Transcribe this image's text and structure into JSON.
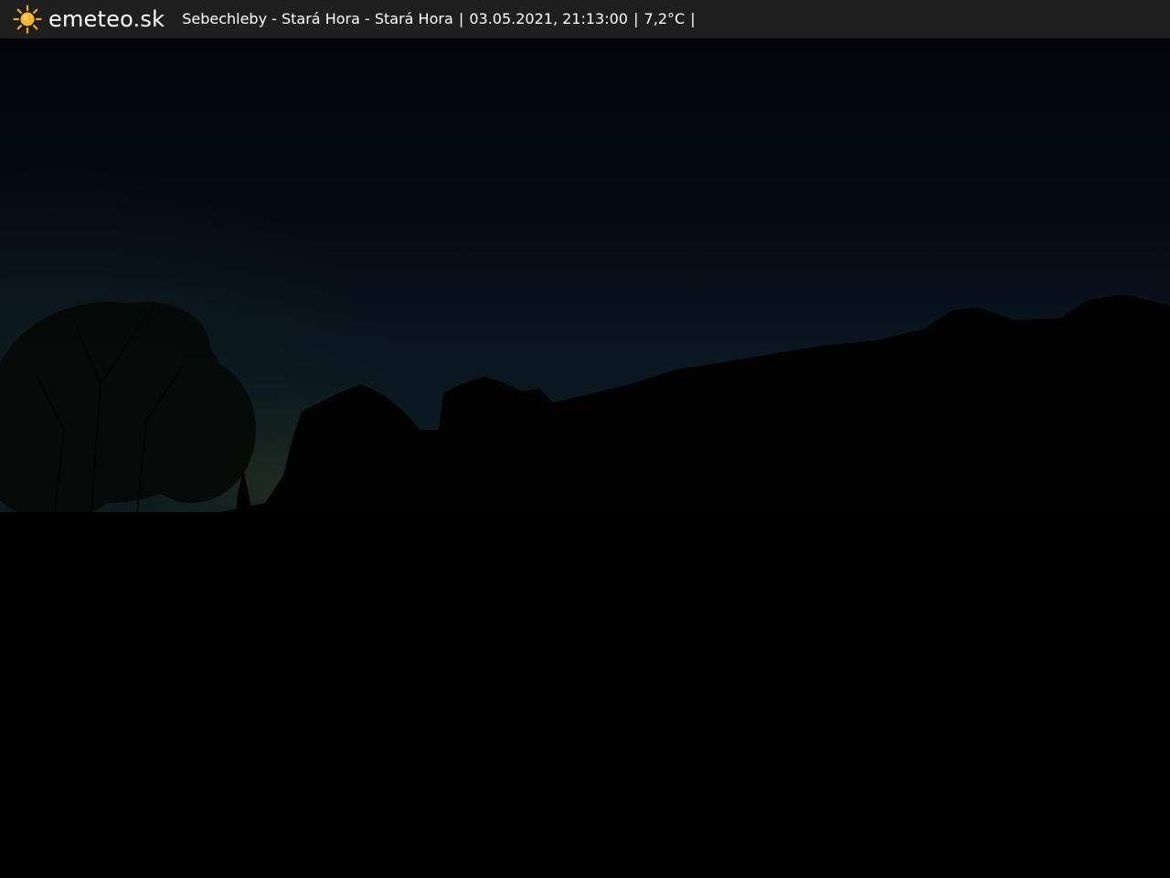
{
  "header": {
    "logo_icon": "sun-icon",
    "brand": "emeteo.sk",
    "location": "Sebechleby - Stará Hora - Stará Hora",
    "separator": "|",
    "datetime": "03.05.2021, 21:13:00",
    "temperature": "7,2°C"
  },
  "colors": {
    "header_bg": "#1f1f1f",
    "sun": "#f5a623",
    "sky_top": "#020409",
    "sky_horizon": "#0a1620",
    "ground": "#010101"
  }
}
